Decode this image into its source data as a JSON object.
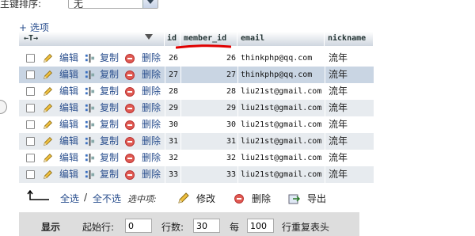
{
  "top": {
    "sort_label": "主键排序:",
    "sort_value": "无"
  },
  "options_link": "+ 选项",
  "columns": {
    "arrows": "←T→",
    "id": "id",
    "member_id": "member_id",
    "email": "email",
    "nickname": "nickname"
  },
  "actions": {
    "edit": "编辑",
    "copy": "复制",
    "delete": "删除"
  },
  "rows": [
    {
      "id": "26",
      "member_id": "26",
      "email": "thinkphp@qq.com",
      "nickname": "流年"
    },
    {
      "id": "27",
      "member_id": "27",
      "email": "thinkphp@qq.com",
      "nickname": "流年"
    },
    {
      "id": "28",
      "member_id": "28",
      "email": "liu21st@gmail.com",
      "nickname": "流年"
    },
    {
      "id": "29",
      "member_id": "29",
      "email": "liu21st@gmail.com",
      "nickname": "流年"
    },
    {
      "id": "30",
      "member_id": "30",
      "email": "liu21st@gmail.com",
      "nickname": "流年"
    },
    {
      "id": "31",
      "member_id": "31",
      "email": "liu21st@gmail.com",
      "nickname": "流年"
    },
    {
      "id": "32",
      "member_id": "32",
      "email": "liu21st@gmail.com",
      "nickname": "流年"
    },
    {
      "id": "33",
      "member_id": "33",
      "email": "liu21st@gmail.com",
      "nickname": "流年"
    }
  ],
  "bulk": {
    "select_all": "全选",
    "sep": "/",
    "deselect_all": "全不选",
    "with_selected": "选中项:",
    "edit": "修改",
    "delete": "删除",
    "export": "导出"
  },
  "display": {
    "label": "显示",
    "start_row_label": "起始行:",
    "start_row": "0",
    "rows_label": "行数:",
    "rows": "30",
    "every_label": "每",
    "every": "100",
    "repeat_label": "行重复表头"
  },
  "colors": {
    "link": "#2a4f8e",
    "highlight_row": "#c9d5e3",
    "stripe": "#e7ebef",
    "annotation": "#e00000"
  }
}
